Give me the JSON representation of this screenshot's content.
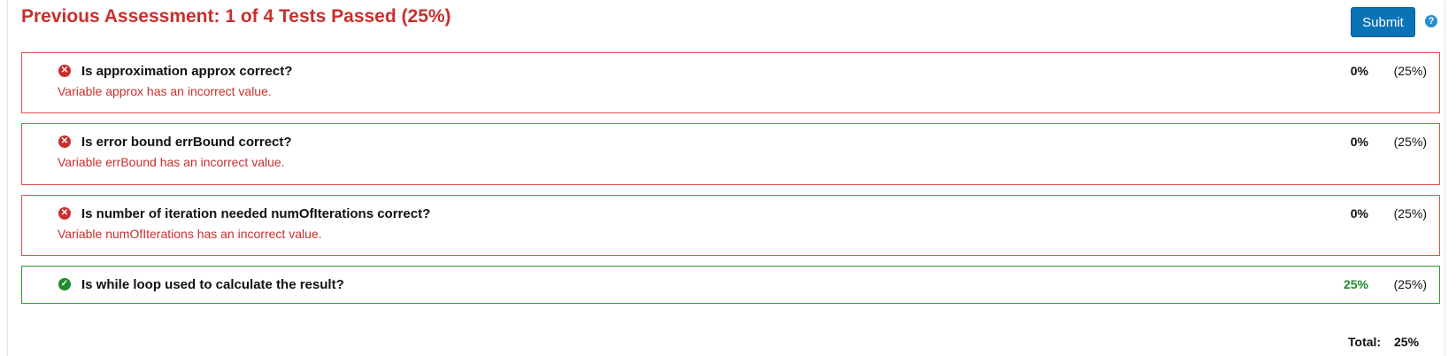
{
  "header": {
    "title": "Previous Assessment: 1 of 4 Tests Passed (25%)",
    "submit_label": "Submit",
    "help_icon": "?"
  },
  "tests": [
    {
      "status": "fail",
      "icon": "✕",
      "question": "Is approximation approx correct?",
      "message": "Variable approx has an incorrect value.",
      "score": "0%",
      "weight": "(25%)"
    },
    {
      "status": "fail",
      "icon": "✕",
      "question": "Is error bound errBound correct?",
      "message": "Variable errBound has an incorrect value.",
      "score": "0%",
      "weight": "(25%)"
    },
    {
      "status": "fail",
      "icon": "✕",
      "question": "Is number of iteration needed numOfIterations correct?",
      "message": "Variable numOfIterations has an incorrect value.",
      "score": "0%",
      "weight": "(25%)"
    },
    {
      "status": "pass",
      "icon": "✓",
      "question": "Is while loop used to calculate the result?",
      "message": "",
      "score": "25%",
      "weight": "(25%)"
    }
  ],
  "total": {
    "label": "Total:",
    "value": "25%"
  },
  "colors": {
    "fail": "#c8302d",
    "pass": "#1e8a2a",
    "button": "#0a73b5"
  }
}
